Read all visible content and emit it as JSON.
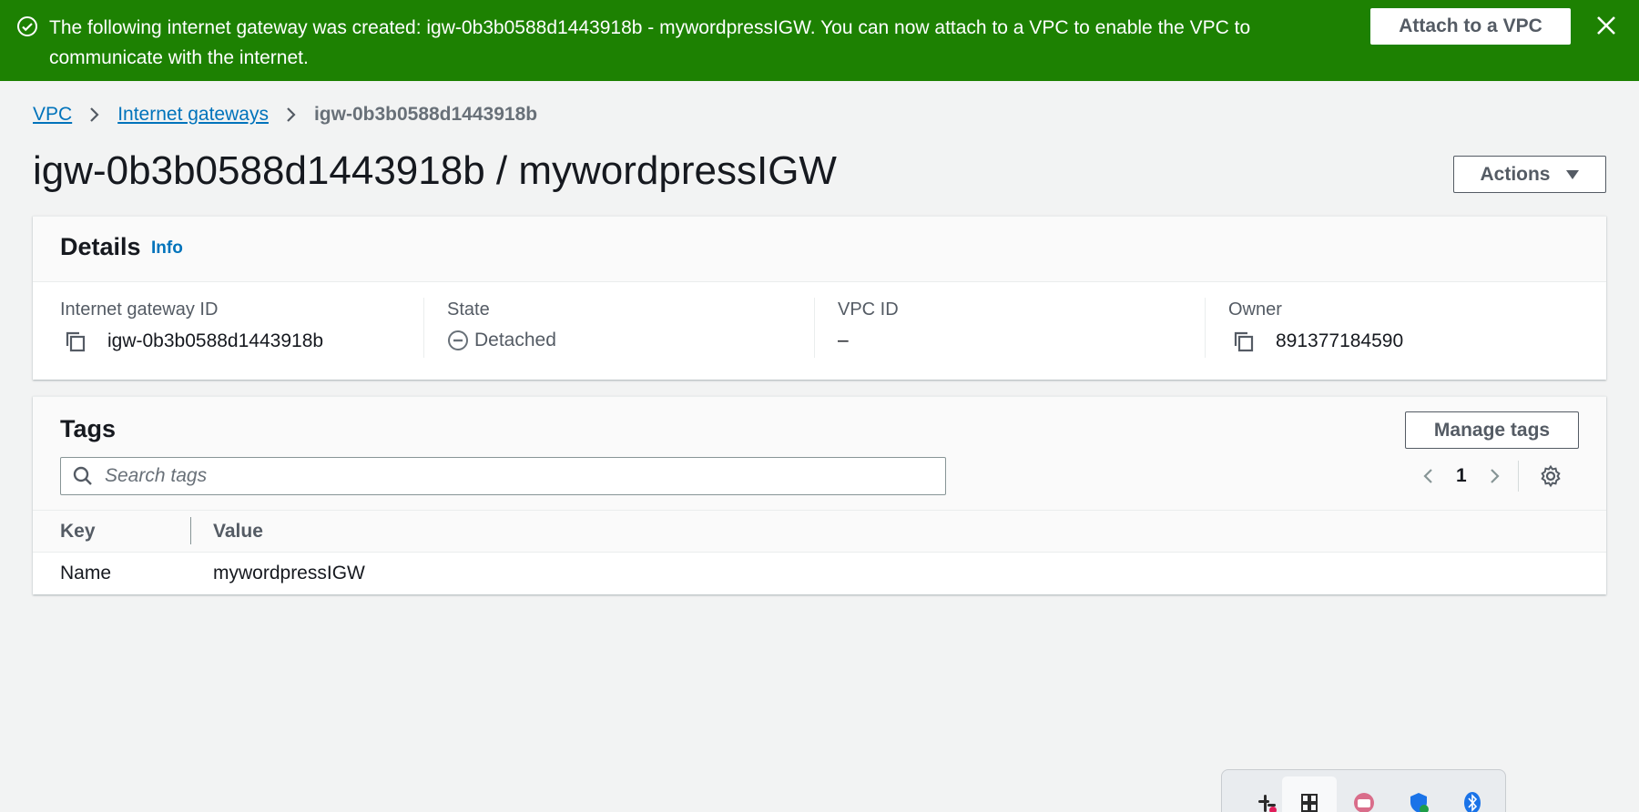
{
  "flash": {
    "message": "The following internet gateway was created: igw-0b3b0588d1443918b - mywordpressIGW. You can now attach to a VPC to enable the VPC to communicate with the internet.",
    "attach_label": "Attach to a VPC",
    "icon": "check-circle-icon",
    "color": "#1d8102"
  },
  "breadcrumb": {
    "items": [
      "VPC",
      "Internet gateways"
    ],
    "current": "igw-0b3b0588d1443918b"
  },
  "page": {
    "title": "igw-0b3b0588d1443918b / mywordpressIGW",
    "actions_label": "Actions"
  },
  "details": {
    "heading": "Details",
    "info_link": "Info",
    "fields": [
      {
        "label": "Internet gateway ID",
        "value": "igw-0b3b0588d1443918b"
      },
      {
        "label": "State",
        "value": "Detached"
      },
      {
        "label": "VPC ID",
        "value": "–"
      },
      {
        "label": "Owner",
        "value": "891377184590"
      }
    ]
  },
  "tags": {
    "heading": "Tags",
    "manage_label": "Manage tags",
    "search_placeholder": "Search tags",
    "page_number": "1",
    "columns": [
      "Key",
      "Value"
    ],
    "rows": [
      {
        "key": "Name",
        "value": "mywordpressIGW"
      }
    ]
  },
  "colors": {
    "link": "#0073bb",
    "background": "#f2f3f3"
  }
}
